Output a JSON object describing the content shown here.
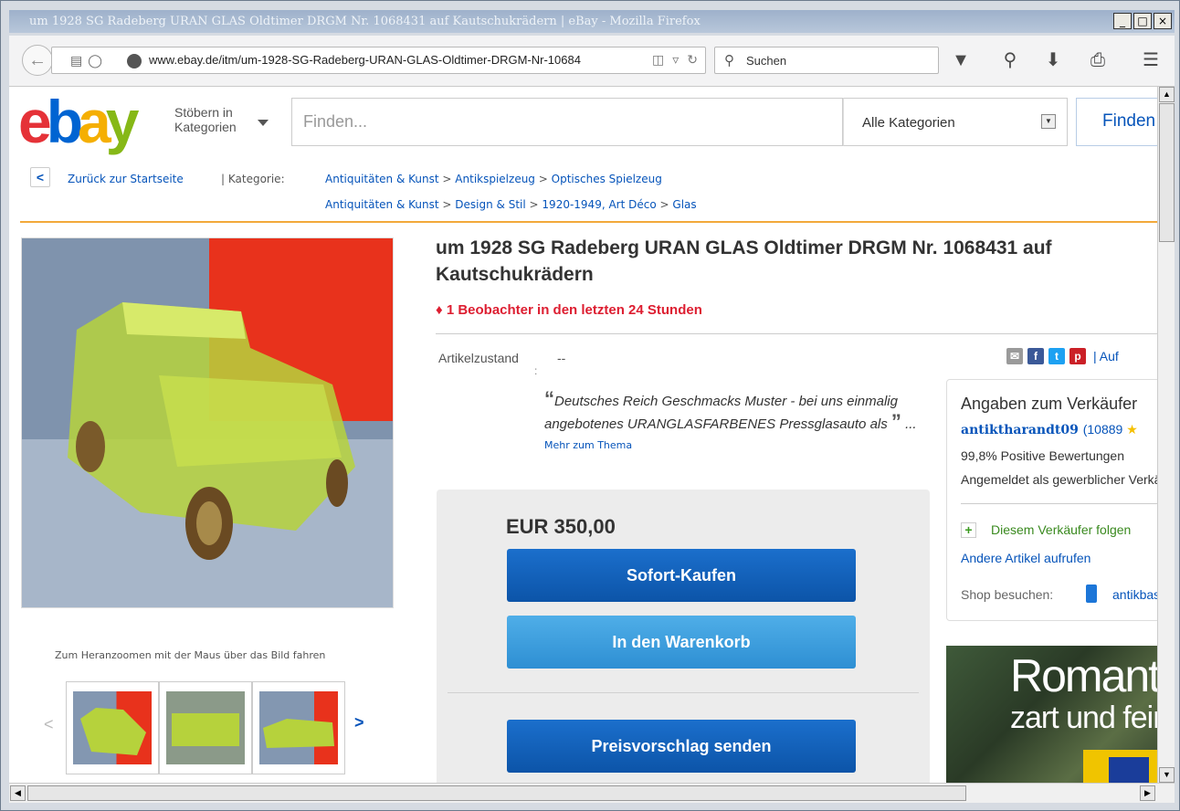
{
  "window": {
    "title": "um 1928 SG Radeberg URAN GLAS Oldtimer DRGM Nr. 1068431 auf Kautschukrädern | eBay - Mozilla Firefox",
    "min": "_",
    "max": "□",
    "close": "×"
  },
  "browser": {
    "url": "www.ebay.de/itm/um-1928-SG-Radeberg-URAN-GLAS-Oldtimer-DRGM-Nr-10684",
    "search_placeholder": "Suchen"
  },
  "ebay": {
    "browse_line1": "Stöbern in",
    "browse_line2": "Kategorien",
    "find_placeholder": "Finden...",
    "category": "Alle Kategorien",
    "find_button": "Finden"
  },
  "breadcrumb": {
    "back": "Zurück zur Startseite",
    "category_label": "| Kategorie:",
    "path1": [
      "Antiquitäten & Kunst",
      "Antikspielzeug",
      "Optisches Spielzeug"
    ],
    "path2": [
      "Antiquitäten & Kunst",
      "Design & Stil",
      "1920-1949, Art Déco",
      "Glas"
    ]
  },
  "gallery": {
    "zoom_hint": "Zum Heranzoomen mit der Maus über das Bild fahren"
  },
  "item": {
    "title": "um 1928 SG Radeberg URAN GLAS Oldtimer DRGM Nr. 1068431 auf Kautschukrädern",
    "watchers": "1 Beobachter in den letzten 24 Stunden",
    "condition_label": "Artikelzustand",
    "condition_colon": ":",
    "condition_value": "--",
    "quote_text": "Deutsches Reich Geschmacks Muster - bei uns einmalig angebotenes URANGLASFARBENES Pressglasauto als",
    "quote_open": "“",
    "quote_close": "”",
    "quote_ellipsis": " ...",
    "more_link": "Mehr zum Thema",
    "share_more": "| Auf"
  },
  "buy": {
    "price": "EUR 350,00",
    "buy_now": "Sofort-Kaufen",
    "add_cart": "In den Warenkorb",
    "offer": "Preisvorschlag senden"
  },
  "seller": {
    "heading": "Angaben zum Verkäufer",
    "name": "antiktharandt09",
    "score": "(10889",
    "positive": "99,8% Positive Bewertungen",
    "registered": "Angemeldet als gewerblicher Verkäufer",
    "follow": "Diesem Verkäufer folgen",
    "other_items": "Andere Artikel aufrufen",
    "shop_label": "Shop besuchen:",
    "shop_name": "antikbasis"
  },
  "ad": {
    "line1": "Romantik",
    "line2": "zart und fein"
  },
  "colors": {
    "ebay_red": "#e53238",
    "ebay_blue": "#0064d2",
    "ebay_yellow": "#f5af02",
    "ebay_green": "#86b817",
    "link_blue": "#0654ba",
    "watch_red": "#dd1e31",
    "rule_orange": "#f2a93b"
  }
}
